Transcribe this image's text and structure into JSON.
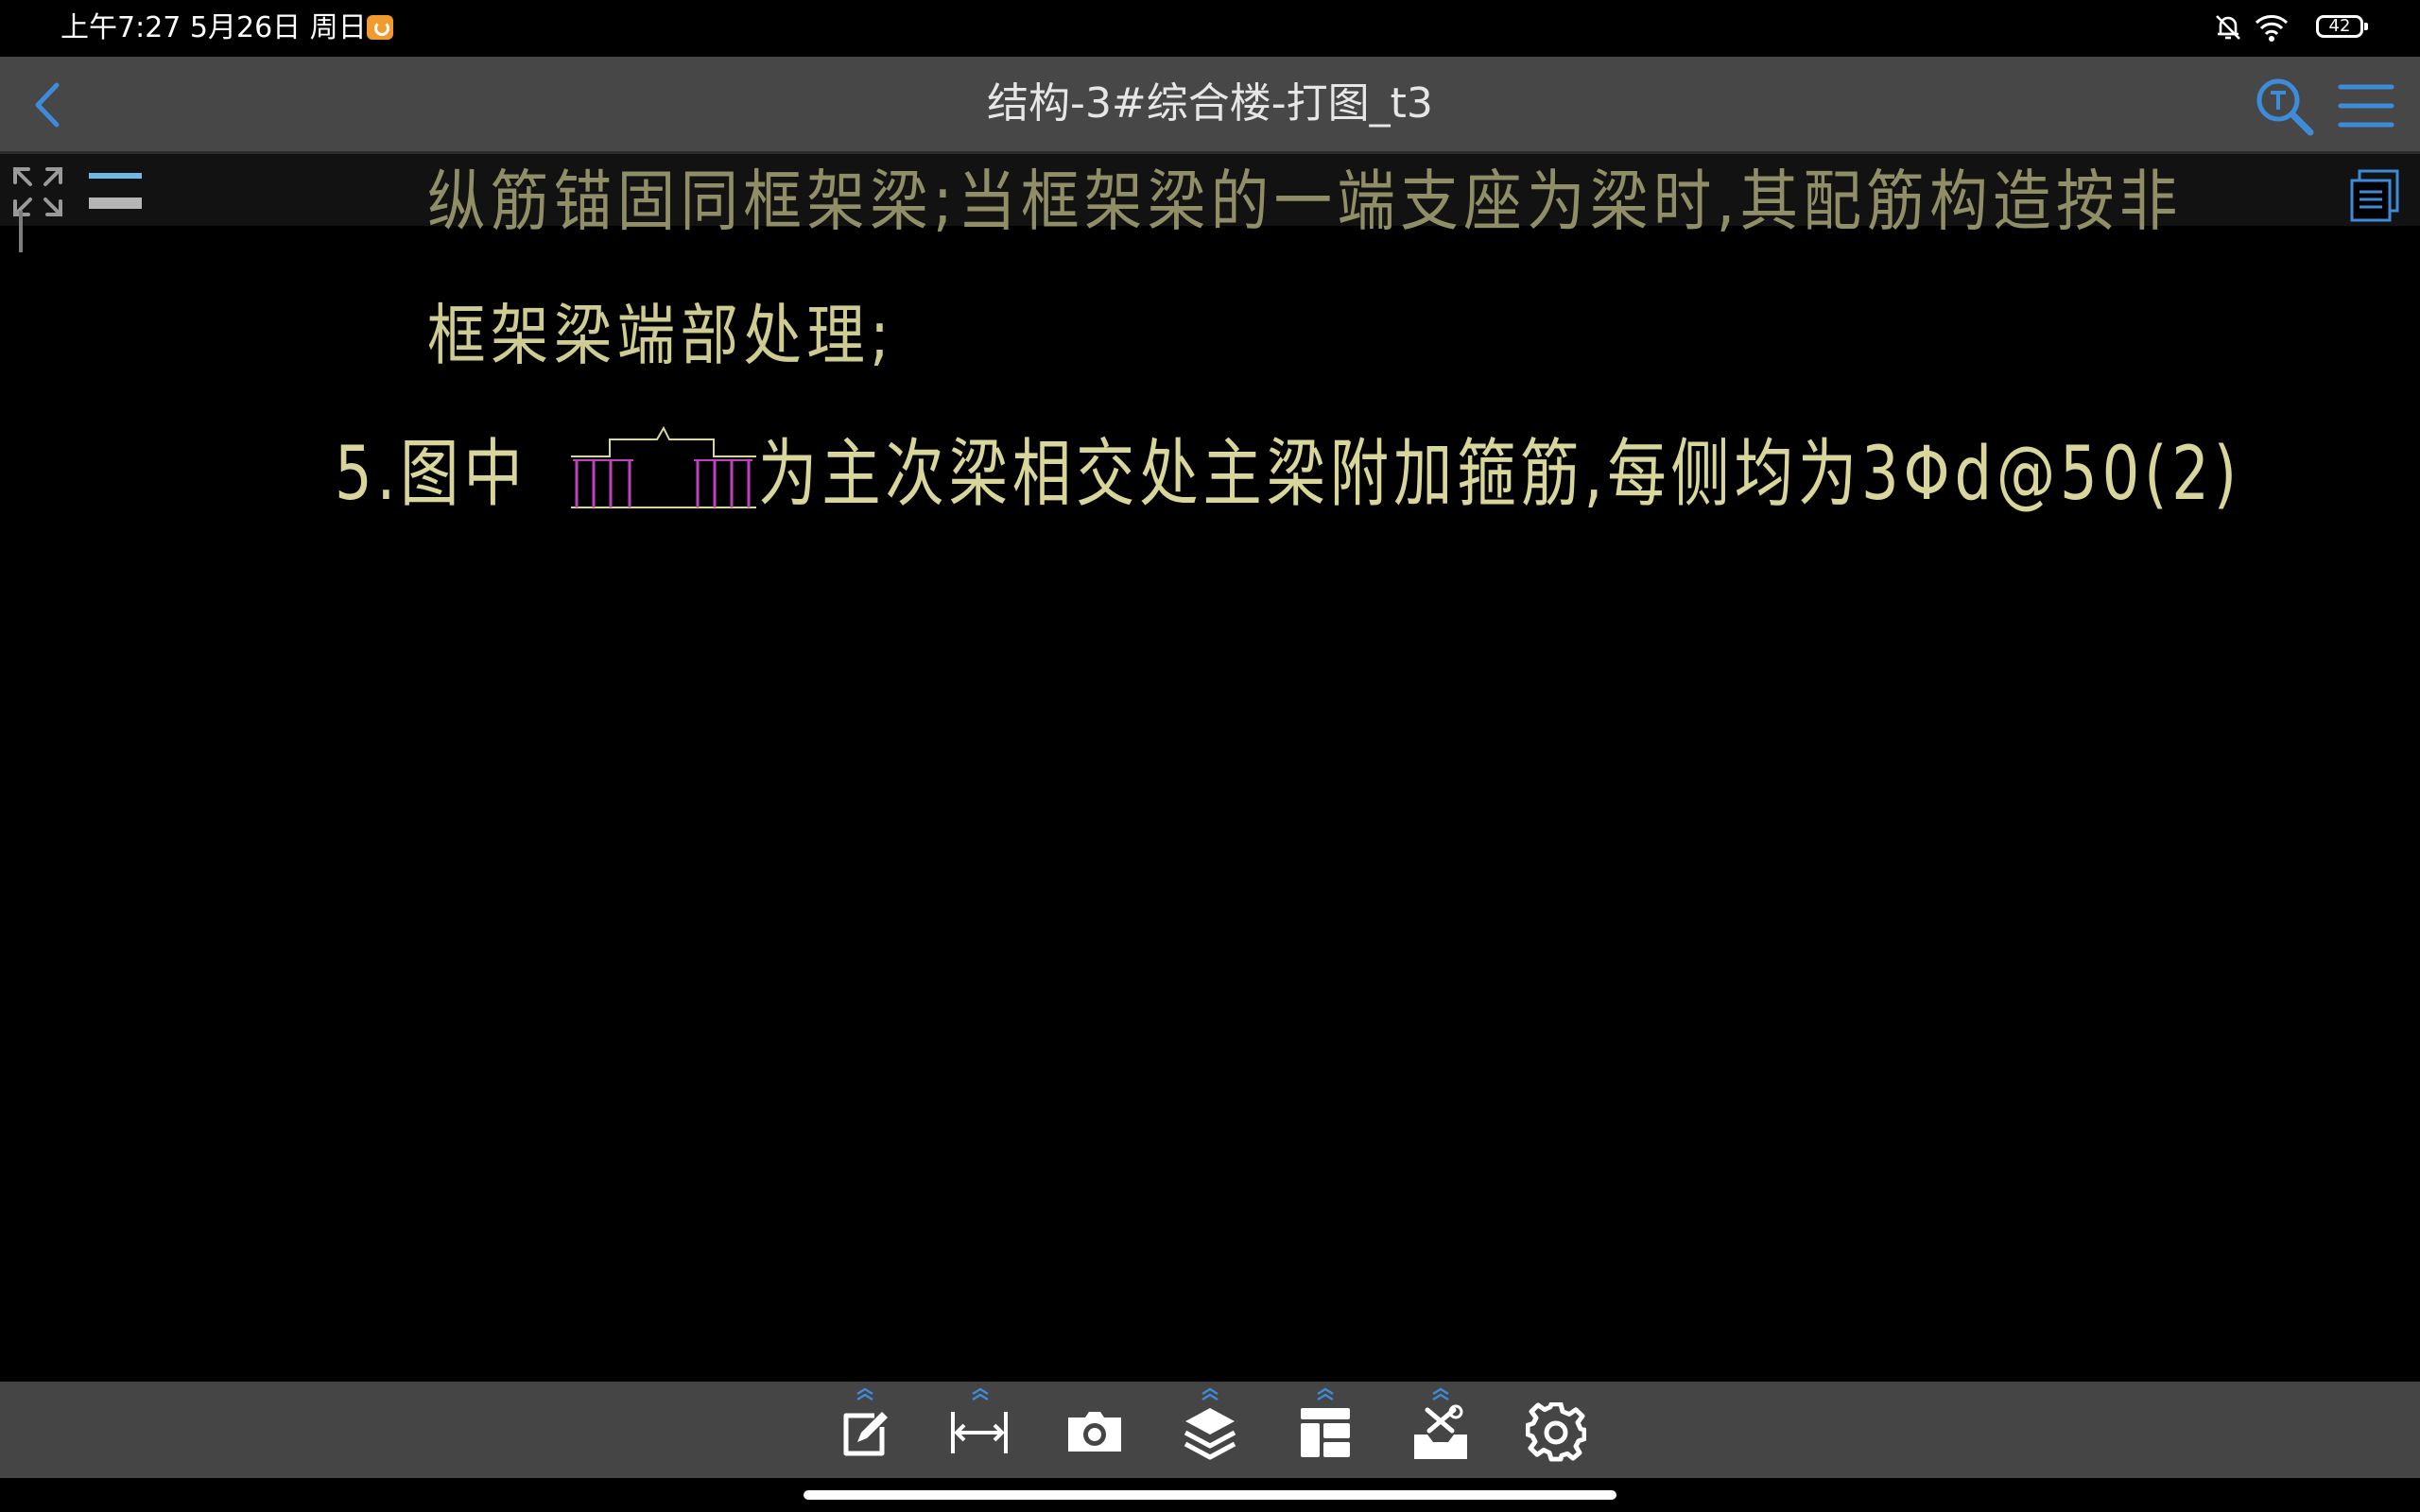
{
  "status_bar": {
    "time_date": "上午7:27 5月26日 周日",
    "battery": "42",
    "icons": [
      "app-notification-icon",
      "mute-icon",
      "wifi-icon",
      "battery-icon"
    ]
  },
  "nav": {
    "title": "结构-3#综合楼-打图_t3",
    "icons": [
      "back-icon",
      "text-search-icon",
      "menu-icon"
    ]
  },
  "drawing": {
    "line1": "纵筋锚固同框架梁;当框架梁的一端支座为梁时,其配筋构造按非",
    "line2": "框架梁端部处理;",
    "line3_prefix": "5.图中",
    "line3_suffix": "为主次梁相交处主梁附加箍筋,每侧均为3Φd@50(2)"
  },
  "overlay_tools": [
    "fullscreen-icon",
    "layout-bars-icon",
    "pages-icon"
  ],
  "toolbar": {
    "buttons": [
      {
        "name": "annotate-icon",
        "has_caret": true
      },
      {
        "name": "measure-icon",
        "has_caret": true
      },
      {
        "name": "camera-icon",
        "has_caret": false
      },
      {
        "name": "layers-icon",
        "has_caret": true
      },
      {
        "name": "layout-icon",
        "has_caret": true
      },
      {
        "name": "tools-icon",
        "has_caret": true
      },
      {
        "name": "settings-icon",
        "has_caret": false
      }
    ]
  },
  "colors": {
    "accent": "#3d8bd9",
    "cad_text": "#d8d69a",
    "cad_magenta": "#c040c0",
    "nav_bg": "#474747"
  }
}
